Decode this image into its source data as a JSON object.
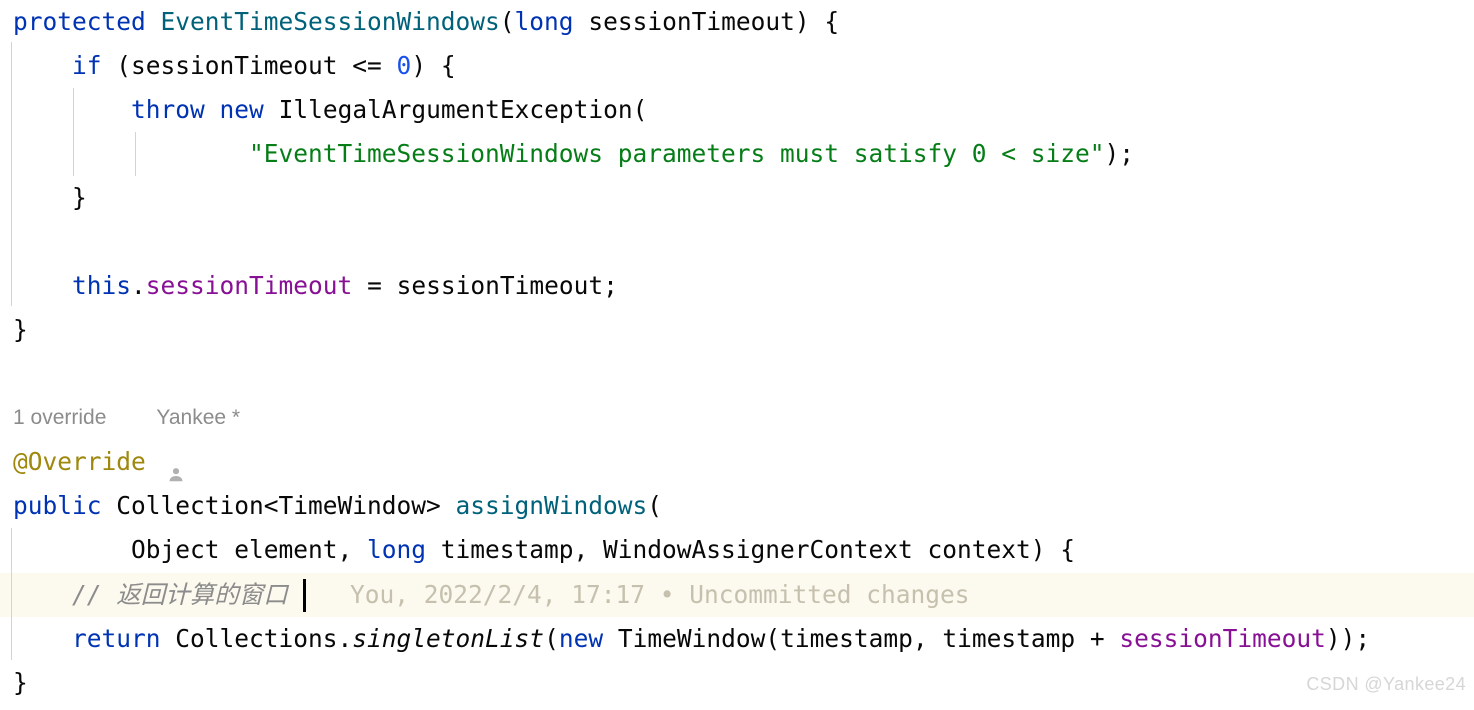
{
  "editor": {
    "background": "#ffffff",
    "caret_line_background": "#fcf9ee",
    "indent_guide_color": "#d3d3d3",
    "colors": {
      "keyword": "#0033b3",
      "class_name": "#00627a",
      "string": "#067d17",
      "number": "#1750eb",
      "field": "#871094",
      "annotation": "#9e880d",
      "comment": "#8c8c8c",
      "plain_text": "#080808",
      "inlay_hint": "#999999",
      "blame_text": "#c6c0ae"
    }
  },
  "code": {
    "line01": {
      "t1": "protected ",
      "t2": "EventTimeSessionWindows",
      "t3": "(",
      "t4": "long",
      "t5": " sessionTimeout) {"
    },
    "line02": {
      "t1": "    ",
      "t2": "if",
      "t3": " (sessionTimeout <= ",
      "t4": "0",
      "t5": ") {"
    },
    "line03": {
      "t1": "        ",
      "t2": "throw",
      "t3": " ",
      "t4": "new",
      "t5": " IllegalArgumentException("
    },
    "line04": {
      "t1": "                ",
      "t2": "\"EventTimeSessionWindows parameters must satisfy 0 < size\"",
      "t3": ");"
    },
    "line05": {
      "t1": "    }"
    },
    "line06": {
      "t1": ""
    },
    "line07": {
      "t1": "    ",
      "t2": "this",
      "t3": ".",
      "t4": "sessionTimeout",
      "t5": " = sessionTimeout;"
    },
    "line08": {
      "t1": "}"
    },
    "line09": {
      "t1": ""
    },
    "line11": {
      "t1": "@Override"
    },
    "line12": {
      "t1": "public",
      "t2": " Collection<TimeWindow> ",
      "t3": "assignWindows",
      "t4": "("
    },
    "line13": {
      "t1": "        Object element, ",
      "t2": "long",
      "t3": " timestamp, WindowAssignerContext context) {"
    },
    "line14": {
      "t1": "    ",
      "t2": "// 返回计算的窗口"
    },
    "line15": {
      "t1": "    ",
      "t2": "return",
      "t3": " Collections.",
      "t4": "singletonList",
      "t5": "(",
      "t6": "new",
      "t7": " TimeWindow(timestamp, timestamp + ",
      "t8": "sessionTimeout",
      "t9": "));"
    },
    "line16": {
      "t1": "}"
    }
  },
  "inlay_hint": {
    "override_count": "1 override",
    "author": "Yankee *",
    "icon": "person-icon"
  },
  "blame": {
    "text": "You, 2022/2/4, 17:17 • Uncommitted changes"
  },
  "watermark": {
    "text": "CSDN @Yankee24"
  }
}
